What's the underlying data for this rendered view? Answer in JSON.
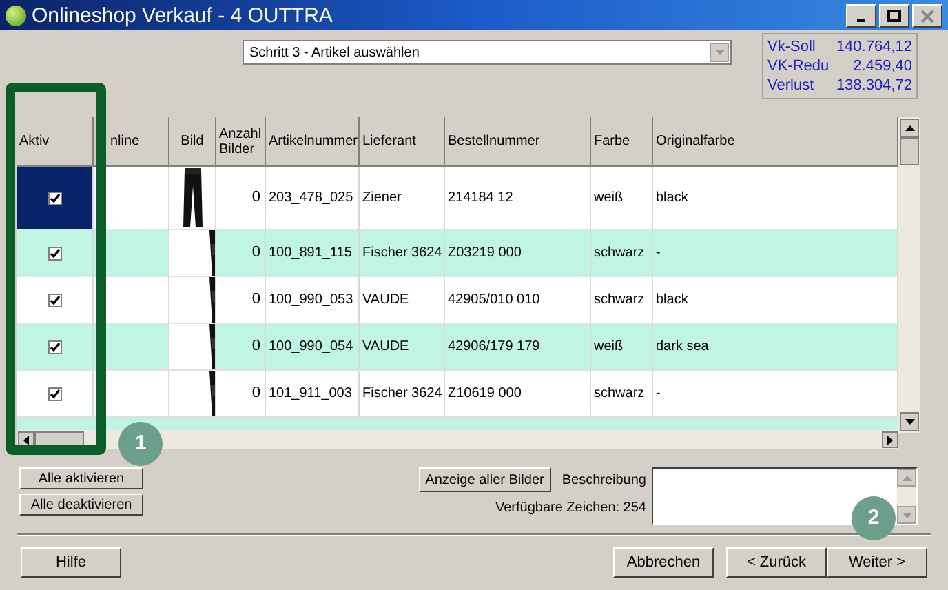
{
  "window": {
    "title": "Onlineshop Verkauf - 4 OUTTRA"
  },
  "step_dropdown": {
    "value": "Schritt 3 - Artikel auswählen"
  },
  "summary": [
    {
      "label": "Vk-Soll",
      "value": "140.764,12"
    },
    {
      "label": "VK-Redu",
      "value": "2.459,40"
    },
    {
      "label": "Verlust",
      "value": "138.304,72"
    }
  ],
  "table": {
    "columns": [
      "Aktiv",
      "nline",
      "Bild",
      "Anzahl Bilder",
      "Artikelnummer",
      "Lieferant",
      "Bestellnummer",
      "Farbe",
      "Originalfarbe"
    ],
    "rows": [
      {
        "selected": true,
        "active": true,
        "kind": "full",
        "anzahl": "0",
        "artikelnummer": "203_478_025",
        "lieferant": "Ziener",
        "bestellnummer": "214184 12",
        "farbe": "weiß",
        "originalfarbe": "black"
      },
      {
        "selected": false,
        "active": true,
        "kind": "cropped",
        "anzahl": "0",
        "artikelnummer": "100_891_115",
        "lieferant": "Fischer 3624",
        "bestellnummer": "Z03219 000",
        "farbe": "schwarz",
        "originalfarbe": "-"
      },
      {
        "selected": false,
        "active": true,
        "kind": "cropped",
        "anzahl": "0",
        "artikelnummer": "100_990_053",
        "lieferant": "VAUDE",
        "bestellnummer": "42905/010 010",
        "farbe": "schwarz",
        "originalfarbe": "black"
      },
      {
        "selected": false,
        "active": true,
        "kind": "cropped",
        "anzahl": "0",
        "artikelnummer": "100_990_054",
        "lieferant": "VAUDE",
        "bestellnummer": "42906/179 179",
        "farbe": "weiß",
        "originalfarbe": "dark sea"
      },
      {
        "selected": false,
        "active": true,
        "kind": "cropped",
        "anzahl": "0",
        "artikelnummer": "101_911_003",
        "lieferant": "Fischer 3624",
        "bestellnummer": "Z10619 000",
        "farbe": "schwarz",
        "originalfarbe": "-"
      }
    ]
  },
  "buttons_left": [
    "Alle aktivieren",
    "Alle deaktivieren"
  ],
  "show_images_button": "Anzeige aller Bilder",
  "description": {
    "label": "Beschreibung",
    "available": "Verfügbare Zeichen: 254"
  },
  "footer_buttons": [
    "Hilfe",
    "Abbrechen",
    "< Zurück",
    "Weiter >"
  ],
  "annotations": [
    "1",
    "2"
  ]
}
